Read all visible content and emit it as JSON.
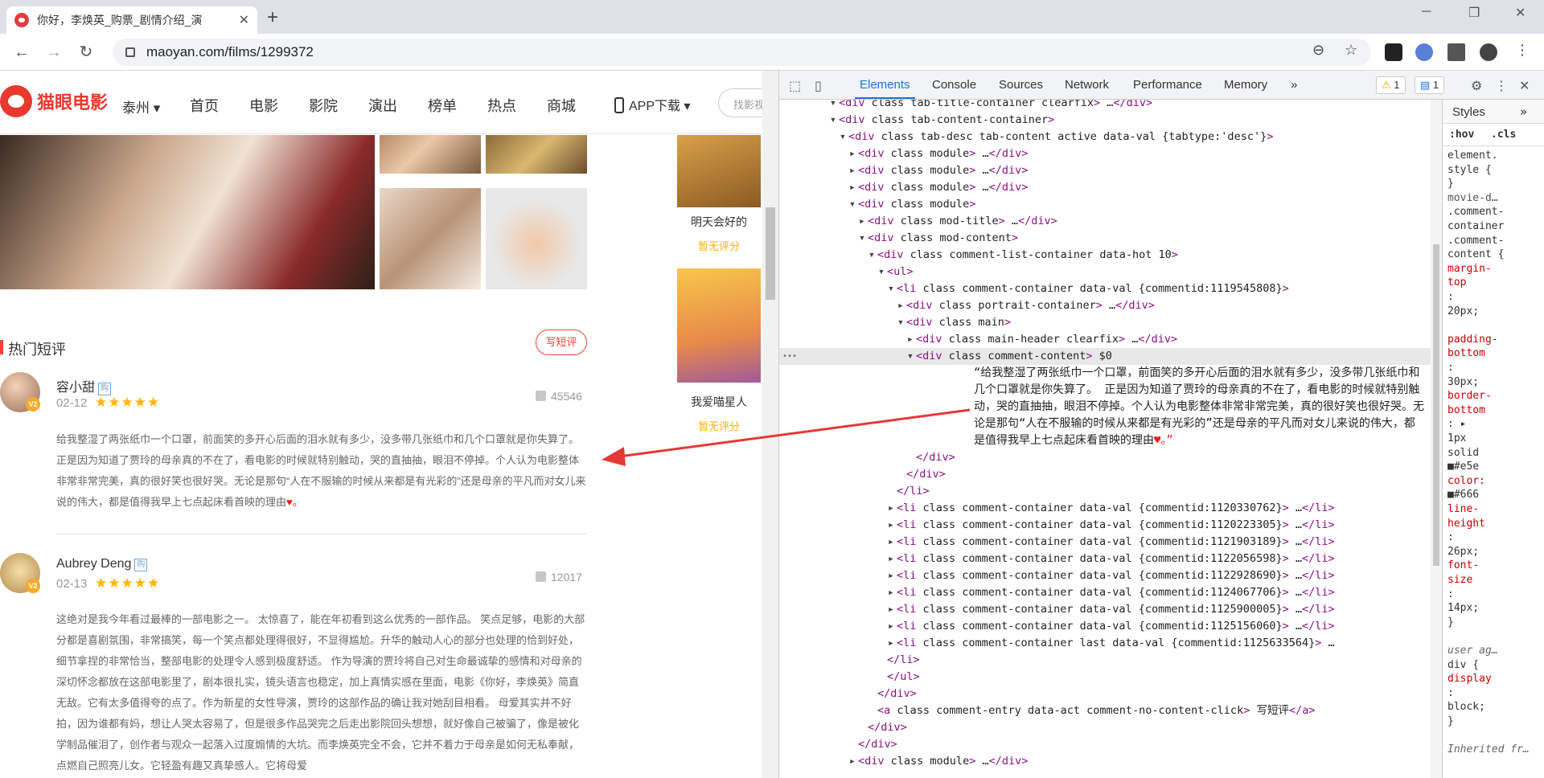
{
  "browser": {
    "tab_title": "你好，李焕英_购票_剧情介绍_演",
    "tab_close": "✕",
    "new_tab": "+",
    "url": "maoyan.com/films/1299372",
    "win_min": "─",
    "win_max": "❐",
    "win_close": "✕"
  },
  "site": {
    "logo_text": "猫眼电影",
    "city": "泰州",
    "nav": [
      "首页",
      "电影",
      "影院",
      "演出",
      "榜单",
      "热点",
      "商城"
    ],
    "app_download": "APP下载",
    "search_placeholder": "找影视"
  },
  "sidebar_movies": [
    {
      "name": "明天会好的",
      "score": "暂无评分"
    },
    {
      "name": "我爱喵星人",
      "score": "暂无评分"
    }
  ],
  "comments_section": {
    "title": "热门短评",
    "write_button": "写短评"
  },
  "comments": [
    {
      "user": "容小甜",
      "date": "02-12",
      "stars": "★★★★★",
      "likes": "45546",
      "text": "给我整湿了两张纸巾一个口罩，前面笑的多开心后面的泪水就有多少，没多带几张纸巾和几个口罩就是你失算了。 正是因为知道了贾玲的母亲真的不在了，看电影的时候就特别触动，哭的直抽抽，眼泪不停掉。个人认为电影整体非常非常完美，真的很好笑也很好哭。无论是那句“人在不服输的时候从来都是有光彩的”还是母亲的平凡而对女儿来说的伟大，都是值得我早上七点起床看首映的理由",
      "heart": "♥。"
    },
    {
      "user": "Aubrey Deng",
      "date": "02-13",
      "stars": "★★★★★",
      "likes": "12017",
      "text": "这绝对是我今年看过最棒的一部电影之一。 太惊喜了，能在年初看到这么优秀的一部作品。 笑点足够，电影的大部分都是喜剧氛围，非常搞笑，每一个笑点都处理得很好，不显得尴尬。升华的触动人心的部分也处理的恰到好处，细节拿捏的非常恰当，整部电影的处理令人感到极度舒适。 作为导演的贾玲将自己对生命最诚挚的感情和对母亲的深切怀念都放在这部电影里了，剧本很扎实，镜头语言也稳定，加上真情实感在里面，电影《你好，李焕英》简直无敌。它有太多值得夸的点了。作为新星的女性导演，贾玲的这部作品的确让我对她刮目相看。 母爱其实并不好拍，因为谁都有妈，想让人哭太容易了，但是很多作品哭完之后走出影院回头想想，就好像自己被骗了，像是被化学制品催泪了，创作者与观众一起落入过度煽情的大坑。而李焕英完全不会，它并不着力于母亲是如何无私奉献，点燃自己照亮儿女。它轻盈有趣又真挚感人。它将母爱"
    }
  ],
  "devtools": {
    "tabs": [
      "Elements",
      "Console",
      "Sources",
      "Network",
      "Performance",
      "Memory"
    ],
    "more": "»",
    "warn_count": "1",
    "msg_count": "1",
    "styles_tab": "Styles",
    "styles_more": "»",
    "filter_hov": ":hov",
    "filter_cls": ".cls",
    "dom_lines": [
      {
        "indent": 5,
        "tri": "▾",
        "html": "<div class=\"tab-title-container clearfix\">…</div>"
      },
      {
        "indent": 5,
        "tri": "▾",
        "html": "<div class=\"tab-content-container\">"
      },
      {
        "indent": 6,
        "tri": "▾",
        "html": "<div class=\"tab-desc tab-content active\" data-val=\"{tabtype:'desc'}\">"
      },
      {
        "indent": 7,
        "tri": "▸",
        "html": "<div class=\"module\">…</div>"
      },
      {
        "indent": 7,
        "tri": "▸",
        "html": "<div class=\"module\">…</div>"
      },
      {
        "indent": 7,
        "tri": "▸",
        "html": "<div class=\"module\">…</div>"
      },
      {
        "indent": 7,
        "tri": "▾",
        "html": "<div class=\"module\">"
      },
      {
        "indent": 8,
        "tri": "▸",
        "html": "<div class=\"mod-title\">…</div>"
      },
      {
        "indent": 8,
        "tri": "▾",
        "html": "<div class=\"mod-content\">"
      },
      {
        "indent": 9,
        "tri": "▾",
        "html": "<div class=\"comment-list-container\" data-hot=\"10\">"
      },
      {
        "indent": 10,
        "tri": "▾",
        "html": "<ul>"
      },
      {
        "indent": 11,
        "tri": "▾",
        "html": "<li class=\"comment-container \" data-val=\"{commentid:1119545808}\">"
      },
      {
        "indent": 12,
        "tri": "▸",
        "html": "<div class=\"portrait-container\">…</div>"
      },
      {
        "indent": 12,
        "tri": "▾",
        "html": "<div class=\"main\">"
      },
      {
        "indent": 13,
        "tri": "▸",
        "html": "<div class=\"main-header clearfix\">…</div>"
      },
      {
        "indent": 13,
        "tri": "▾",
        "html": "<div class=\"comment-content\"> == $0"
      }
    ],
    "dom_text": "“给我整湿了两张纸巾一个口罩，前面笑的多开心后面的泪水就有多少，没多带几张纸巾和几个口罩就是你失算了。 正是因为知道了贾玲的母亲真的不在了，看电影的时候就特别触动，哭的直抽抽，眼泪不停掉。个人认为电影整体非常非常完美，真的很好笑也很好哭。无论是那句“人在不服输的时候从来都是有光彩的”还是母亲的平凡而对女儿来说的伟大，都是值得我早上七点起床看首映的理由",
    "dom_text_end": "♥。”",
    "dom_lines_after": [
      {
        "indent": 13,
        "tri": "",
        "html": "</div>"
      },
      {
        "indent": 12,
        "tri": "",
        "html": "</div>"
      },
      {
        "indent": 11,
        "tri": "",
        "html": "</li>"
      },
      {
        "indent": 11,
        "tri": "▸",
        "html": "<li class=\"comment-container \" data-val=\"{commentid:1120330762}\">…</li>"
      },
      {
        "indent": 11,
        "tri": "▸",
        "html": "<li class=\"comment-container \" data-val=\"{commentid:1120223305}\">…</li>"
      },
      {
        "indent": 11,
        "tri": "▸",
        "html": "<li class=\"comment-container \" data-val=\"{commentid:1121903189}\">…</li>"
      },
      {
        "indent": 11,
        "tri": "▸",
        "html": "<li class=\"comment-container \" data-val=\"{commentid:1122056598}\">…</li>"
      },
      {
        "indent": 11,
        "tri": "▸",
        "html": "<li class=\"comment-container \" data-val=\"{commentid:1122928690}\">…</li>"
      },
      {
        "indent": 11,
        "tri": "▸",
        "html": "<li class=\"comment-container \" data-val=\"{commentid:1124067706}\">…</li>"
      },
      {
        "indent": 11,
        "tri": "▸",
        "html": "<li class=\"comment-container \" data-val=\"{commentid:1125900005}\">…</li>"
      },
      {
        "indent": 11,
        "tri": "▸",
        "html": "<li class=\"comment-container \" data-val=\"{commentid:1125156060}\">…</li>"
      },
      {
        "indent": 11,
        "tri": "▸",
        "html": "<li class=\"comment-container last\" data-val=\"{commentid:1125633564}\">…"
      },
      {
        "indent": 10,
        "tri": "",
        "html": "</li>"
      },
      {
        "indent": 10,
        "tri": "",
        "html": "</ul>"
      },
      {
        "indent": 9,
        "tri": "",
        "html": "</div>"
      },
      {
        "indent": 9,
        "tri": "",
        "html": "<a class=\"comment-entry\" data-act=\"comment-no-content-click\">写短评</a>"
      },
      {
        "indent": 8,
        "tri": "",
        "html": "</div>"
      },
      {
        "indent": 7,
        "tri": "",
        "html": "</div>"
      },
      {
        "indent": 7,
        "tri": "▸",
        "html": "<div class=\"module\">…</div>"
      }
    ],
    "styles_lines": [
      {
        "t": "element.",
        "c": ""
      },
      {
        "t": "style {",
        "c": ""
      },
      {
        "t": "}",
        "c": ""
      },
      {
        "t": "   movie-d…",
        "c": "link"
      },
      {
        "t": ".comment-",
        "c": ""
      },
      {
        "t": "container",
        "c": ""
      },
      {
        "t": ".comment-",
        "c": ""
      },
      {
        "t": "content {",
        "c": ""
      },
      {
        "t": "  margin-",
        "c": "prop"
      },
      {
        "t": "     top",
        "c": "prop"
      },
      {
        "t": "      :",
        "c": ""
      },
      {
        "t": "     20px;",
        "c": ""
      },
      {
        "t": "",
        "c": ""
      },
      {
        "t": "padding-",
        "c": "prop"
      },
      {
        "t": "     bottom",
        "c": "prop"
      },
      {
        "t": "      :",
        "c": ""
      },
      {
        "t": "     30px;",
        "c": ""
      },
      {
        "t": "border-",
        "c": "prop"
      },
      {
        "t": "     bottom",
        "c": "prop"
      },
      {
        "t": "      : ▸",
        "c": ""
      },
      {
        "t": "     1px",
        "c": ""
      },
      {
        "t": "     solid",
        "c": ""
      },
      {
        "t": "     ■#e5e",
        "c": ""
      },
      {
        "t": "  color:",
        "c": "prop"
      },
      {
        "t": "     ■#666",
        "c": ""
      },
      {
        "t": "  line-",
        "c": "prop"
      },
      {
        "t": "     height",
        "c": "prop"
      },
      {
        "t": "      :",
        "c": ""
      },
      {
        "t": "     26px;",
        "c": ""
      },
      {
        "t": "  font-",
        "c": "prop"
      },
      {
        "t": "     size",
        "c": "prop"
      },
      {
        "t": "      :",
        "c": ""
      },
      {
        "t": "     14px;",
        "c": ""
      },
      {
        "t": "}",
        "c": ""
      },
      {
        "t": "",
        "c": ""
      },
      {
        "t": "  user ag…",
        "c": "ua"
      },
      {
        "t": "div {",
        "c": ""
      },
      {
        "t": "  display",
        "c": "prop"
      },
      {
        "t": "      :",
        "c": ""
      },
      {
        "t": "     block;",
        "c": ""
      },
      {
        "t": "}",
        "c": ""
      },
      {
        "t": "",
        "c": ""
      },
      {
        "t": "Inherited fr…",
        "c": "ua"
      }
    ]
  }
}
